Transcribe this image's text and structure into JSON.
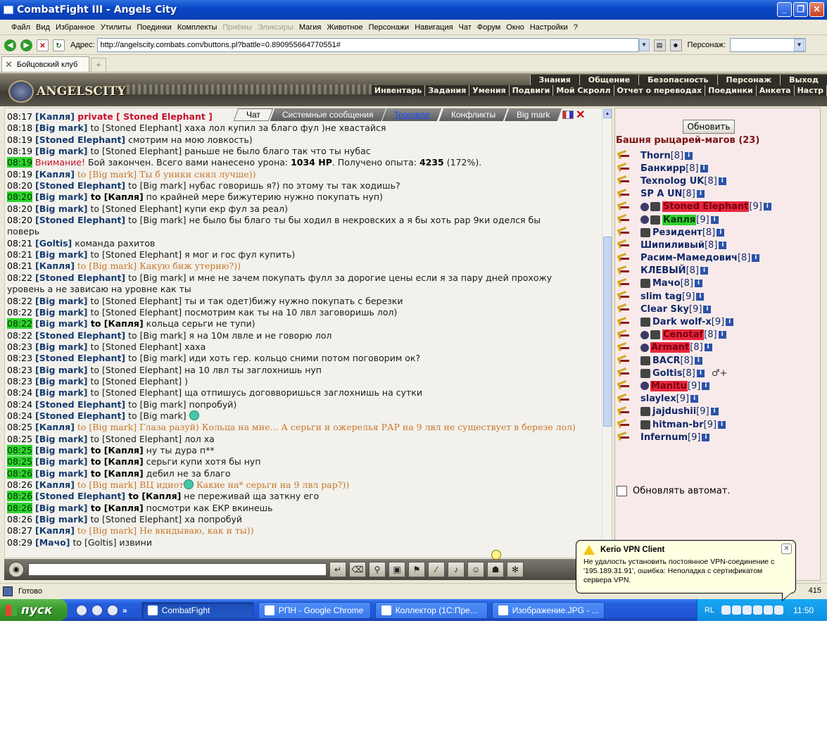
{
  "window": {
    "title": "CombatFight III - Angels City"
  },
  "menu": [
    "Файл",
    "Вид",
    "Избранное",
    "Утилиты",
    "Поединки",
    "Комплекты",
    "Приёмы",
    "Эликсиры",
    "Магия",
    "Животное",
    "Персонажи",
    "Навигация",
    "Чат",
    "Форум",
    "Окно",
    "Настройки",
    "?"
  ],
  "menu_disabled": [
    "Приёмы",
    "Эликсиры"
  ],
  "address": {
    "label": "Адрес:",
    "url": "http://angelscity.combats.com/buttons.pl?battle=0.890955664770551#",
    "char_label": "Персонаж:"
  },
  "tabs": {
    "main": "Бойцовский клуб",
    "new": "+"
  },
  "banner": {
    "logo_text": "ANGELSCITY",
    "top_menu": [
      "Знания",
      "Общение",
      "Безопасность",
      "Персонаж",
      "Выход"
    ],
    "sub_menu": [
      "Инвентарь",
      "Задания",
      "Умения",
      "Подвиги",
      "Мой Скролл",
      "Отчет о переводах",
      "Поединки",
      "Анкета",
      "Настр"
    ]
  },
  "chat": {
    "tabs": [
      "Чат",
      "Системные сообщения",
      "Торговля",
      "Конфликты",
      "Big mark"
    ],
    "lines": [
      {
        "t": "08:17",
        "parts": [
          {
            "k": "nick",
            "v": "[Капля]"
          },
          {
            "k": "priv",
            "v": " private [ Stoned Elephant ]"
          }
        ]
      },
      {
        "t": "08:18",
        "parts": [
          {
            "k": "nick",
            "v": "[Big mark]"
          },
          {
            "k": "txt",
            "v": " to [Stoned Elephant] хаха лол купил за благо фул )не хвастайся"
          }
        ]
      },
      {
        "t": "08:19",
        "parts": [
          {
            "k": "nick",
            "v": "[Stoned Elephant]"
          },
          {
            "k": "txt",
            "v": " смотрим на мою ловкость)"
          }
        ]
      },
      {
        "t": "08:19",
        "parts": [
          {
            "k": "nick",
            "v": "[Big mark]"
          },
          {
            "k": "txt",
            "v": " to [Stoned Elephant] раньше не было благо так что ты нубас"
          }
        ]
      },
      {
        "t": "08:19",
        "hl": true,
        "parts": [
          {
            "k": "sys",
            "v": "Внимание!"
          },
          {
            "k": "txt",
            "v": " Бой закончен. Всего вами нанесено урона: "
          },
          {
            "k": "b",
            "v": "1034 HP"
          },
          {
            "k": "txt",
            "v": ". Получено опыта: "
          },
          {
            "k": "b",
            "v": "4235"
          },
          {
            "k": "txt",
            "v": " (172%)."
          }
        ]
      },
      {
        "t": "08:19",
        "parts": [
          {
            "k": "nick",
            "v": "[Капля]"
          },
          {
            "k": "orange",
            "v": " to [Big mark] Ты б уники снял лучше))"
          }
        ]
      },
      {
        "t": "08:20",
        "parts": [
          {
            "k": "nick",
            "v": "[Stoned Elephant]"
          },
          {
            "k": "txt",
            "v": " to [Big mark] нубас говоришь я?) по этому ты так ходишь?"
          }
        ]
      },
      {
        "t": "08:20",
        "hl": true,
        "parts": [
          {
            "k": "nick",
            "v": "[Big mark]"
          },
          {
            "k": "bnick",
            "v": " to [Капля]"
          },
          {
            "k": "txt",
            "v": " по крайней мере бижутерию нужно покупать нуп)"
          }
        ]
      },
      {
        "t": "08:20",
        "parts": [
          {
            "k": "nick",
            "v": "[Big mark]"
          },
          {
            "k": "txt",
            "v": " to [Stoned Elephant] купи екр фул за реал)"
          }
        ]
      },
      {
        "t": "08:20",
        "parts": [
          {
            "k": "nick",
            "v": "[Stoned Elephant]"
          },
          {
            "k": "txt",
            "v": " to [Big mark] не было бы благо ты бы ходил в некровских а я бы хоть рар 9ки оделся бы"
          }
        ]
      },
      {
        "t": "",
        "parts": [
          {
            "k": "txt",
            "v": "поверь"
          }
        ]
      },
      {
        "t": "08:21",
        "parts": [
          {
            "k": "nick",
            "v": "[Goltis]"
          },
          {
            "k": "txt",
            "v": " команда рахитов"
          }
        ]
      },
      {
        "t": "08:21",
        "parts": [
          {
            "k": "nick",
            "v": "[Big mark]"
          },
          {
            "k": "txt",
            "v": " to [Stoned Elephant] я мог и гос фул купить)"
          }
        ]
      },
      {
        "t": "08:21",
        "parts": [
          {
            "k": "nick",
            "v": "[Капля]"
          },
          {
            "k": "orange",
            "v": " to [Big mark] Какую биж утерию?))"
          }
        ]
      },
      {
        "t": "08:22",
        "parts": [
          {
            "k": "nick",
            "v": "[Stoned Elephant]"
          },
          {
            "k": "txt",
            "v": " to [Big mark] и мне не зачем покупать фулл за дорогие цены если я за пару дней прохожу"
          }
        ]
      },
      {
        "t": "",
        "parts": [
          {
            "k": "txt",
            "v": "уровень а не зависаю на уровне как ты"
          }
        ]
      },
      {
        "t": "08:22",
        "parts": [
          {
            "k": "nick",
            "v": "[Big mark]"
          },
          {
            "k": "txt",
            "v": " to [Stoned Elephant] ты и так одет)бижу нужно покупать с березки"
          }
        ]
      },
      {
        "t": "08:22",
        "parts": [
          {
            "k": "nick",
            "v": "[Big mark]"
          },
          {
            "k": "txt",
            "v": " to [Stoned Elephant] посмотрим как ты на 10 лвл заговоришь лол)"
          }
        ]
      },
      {
        "t": "08:22",
        "hl": true,
        "parts": [
          {
            "k": "nick",
            "v": "[Big mark]"
          },
          {
            "k": "bnick",
            "v": " to [Капля]"
          },
          {
            "k": "txt",
            "v": " кольца серьги не тупи)"
          }
        ]
      },
      {
        "t": "08:22",
        "parts": [
          {
            "k": "nick",
            "v": "[Stoned Elephant]"
          },
          {
            "k": "txt",
            "v": " to [Big mark] я на 10м лвле и не говорю лол"
          }
        ]
      },
      {
        "t": "08:23",
        "parts": [
          {
            "k": "nick",
            "v": "[Big mark]"
          },
          {
            "k": "txt",
            "v": " to [Stoned Elephant] хаха"
          }
        ]
      },
      {
        "t": "08:23",
        "parts": [
          {
            "k": "nick",
            "v": "[Stoned Elephant]"
          },
          {
            "k": "txt",
            "v": " to [Big mark] иди хоть гер. кольцо сними потом поговорим ок?"
          }
        ]
      },
      {
        "t": "08:23",
        "parts": [
          {
            "k": "nick",
            "v": "[Big mark]"
          },
          {
            "k": "txt",
            "v": " to [Stoned Elephant] на 10 лвл ты заглохнишь нуп"
          }
        ]
      },
      {
        "t": "08:23",
        "parts": [
          {
            "k": "nick",
            "v": "[Big mark]"
          },
          {
            "k": "txt",
            "v": " to [Stoned Elephant] )"
          }
        ]
      },
      {
        "t": "08:24",
        "parts": [
          {
            "k": "nick",
            "v": "[Big mark]"
          },
          {
            "k": "txt",
            "v": " to [Stoned Elephant] ща отпишусь договворишься заглохнишь на сутки"
          }
        ]
      },
      {
        "t": "08:24",
        "parts": [
          {
            "k": "nick",
            "v": "[Stoned Elephant]"
          },
          {
            "k": "txt",
            "v": " to [Big mark] попробуй)"
          }
        ]
      },
      {
        "t": "08:24",
        "smile": true,
        "parts": [
          {
            "k": "nick",
            "v": "[Stoned Elephant]"
          },
          {
            "k": "txt",
            "v": " to [Big mark] "
          }
        ]
      },
      {
        "t": "08:25",
        "parts": [
          {
            "k": "nick",
            "v": "[Капля]"
          },
          {
            "k": "orange",
            "v": " to [Big mark] Глаза разуй) Кольца на мне... А серьги и ожерелья РАР на 9 лвл не существует в березе лол)"
          }
        ]
      },
      {
        "t": "08:25",
        "parts": [
          {
            "k": "nick",
            "v": "[Big mark]"
          },
          {
            "k": "txt",
            "v": " to [Stoned Elephant] лол ха"
          }
        ]
      },
      {
        "t": "08:25",
        "hl": true,
        "parts": [
          {
            "k": "nick",
            "v": "[Big mark]"
          },
          {
            "k": "bnick",
            "v": " to [Капля]"
          },
          {
            "k": "txt",
            "v": " ну ты дура п**"
          }
        ]
      },
      {
        "t": "08:25",
        "hl": true,
        "parts": [
          {
            "k": "nick",
            "v": "[Big mark]"
          },
          {
            "k": "bnick",
            "v": " to [Капля]"
          },
          {
            "k": "txt",
            "v": " серьги купи хотя бы нуп"
          }
        ]
      },
      {
        "t": "08:26",
        "hl": true,
        "parts": [
          {
            "k": "nick",
            "v": "[Big mark]"
          },
          {
            "k": "bnick",
            "v": " to [Капля]"
          },
          {
            "k": "txt",
            "v": " дебил не за благо"
          }
        ]
      },
      {
        "t": "08:26",
        "parts": [
          {
            "k": "nick",
            "v": "[Капля]"
          },
          {
            "k": "orange",
            "v": " to [Big mark] ВЦ идиот"
          },
          {
            "k": "smile"
          },
          {
            "k": "orange",
            "v": " Какие на* серьги на 9 лвл рар?))"
          }
        ]
      },
      {
        "t": "08:26",
        "hl": true,
        "parts": [
          {
            "k": "nick",
            "v": "[Stoned Elephant]"
          },
          {
            "k": "bnick",
            "v": " to [Капля]"
          },
          {
            "k": "txt",
            "v": " не переживай ща заткну его"
          }
        ]
      },
      {
        "t": "08:26",
        "hl": true,
        "parts": [
          {
            "k": "nick",
            "v": "[Big mark]"
          },
          {
            "k": "bnick",
            "v": " to [Капля]"
          },
          {
            "k": "txt",
            "v": " посмотри как ЕКР вкинешь"
          }
        ]
      },
      {
        "t": "08:26",
        "parts": [
          {
            "k": "nick",
            "v": "[Big mark]"
          },
          {
            "k": "txt",
            "v": " to [Stoned Elephant] ха попробуй"
          }
        ]
      },
      {
        "t": "08:27",
        "parts": [
          {
            "k": "nick",
            "v": "[Капля]"
          },
          {
            "k": "orange",
            "v": " to [Big mark] Не вкидываю, как и ты))"
          }
        ]
      },
      {
        "t": "08:29",
        "parts": [
          {
            "k": "nick",
            "v": "[Мачо]"
          },
          {
            "k": "txt",
            "v": " to [Goltis] извини"
          }
        ]
      }
    ]
  },
  "online": {
    "refresh_label": "Обновить",
    "room": "Башня рыцарей-магов (23)",
    "users": [
      {
        "name": "Thorn",
        "lvl": "[8]",
        "style": ""
      },
      {
        "name": "Банкирр",
        "lvl": "[8]",
        "style": ""
      },
      {
        "name": "Texnolog UK",
        "lvl": "[8]",
        "style": ""
      },
      {
        "name": "SP A UN",
        "lvl": "[8]",
        "style": ""
      },
      {
        "name": "Stoned Elephant",
        "lvl": "[9]",
        "style": "red",
        "align": true,
        "clan": true
      },
      {
        "name": "Капля",
        "lvl": "[9]",
        "style": "green",
        "align": true,
        "clan": true
      },
      {
        "name": "Резидент",
        "lvl": "[8]",
        "style": "",
        "clan": true
      },
      {
        "name": "Шипиливый",
        "lvl": "[8]",
        "style": ""
      },
      {
        "name": "Расим-Мамедович",
        "lvl": "[8]",
        "style": ""
      },
      {
        "name": "КЛЕВЫЙ",
        "lvl": "[8]",
        "style": ""
      },
      {
        "name": "Мачо",
        "lvl": "[8]",
        "style": "",
        "clan": true
      },
      {
        "name": "slim tag",
        "lvl": "[9]",
        "style": ""
      },
      {
        "name": "Clear Sky",
        "lvl": "[9]",
        "style": ""
      },
      {
        "name": "Dark wolf-x",
        "lvl": "[9]",
        "style": "",
        "clan": true
      },
      {
        "name": "Cenotaf",
        "lvl": "[8]",
        "style": "red",
        "align": true,
        "clan": true
      },
      {
        "name": "Armant",
        "lvl": "[8]",
        "style": "red",
        "align": true
      },
      {
        "name": "BACR",
        "lvl": "[8]",
        "style": "",
        "clan": true
      },
      {
        "name": "Goltis",
        "lvl": "[8]",
        "style": "",
        "clan": true,
        "extra": "♂+"
      },
      {
        "name": "Manitu",
        "lvl": "[9]",
        "style": "red",
        "align": true
      },
      {
        "name": "slaylex",
        "lvl": "[9]",
        "style": ""
      },
      {
        "name": "jajdushii",
        "lvl": "[9]",
        "style": "",
        "clan": true
      },
      {
        "name": "hitman-br",
        "lvl": "[9]",
        "style": "",
        "clan": true
      },
      {
        "name": "Infernum",
        "lvl": "[9]",
        "style": ""
      }
    ],
    "auto_refresh_label": "Обновлять автомат."
  },
  "status": {
    "text": "Готово",
    "counter": "415"
  },
  "taskbar": {
    "start": "пуск",
    "tasks": [
      "CombatFight",
      "РПН - Google Chrome",
      "Коллектор (1С:Пре...",
      "Изображение.JPG - ..."
    ],
    "lang": "RL",
    "clock": "11:50"
  },
  "balloon": {
    "title": "Kerio VPN Client",
    "text": "Не удалость установить постоянное VPN-соединение с '195.189.31.91', ошибка: Неполадка с сертификатом сервера VPN."
  }
}
